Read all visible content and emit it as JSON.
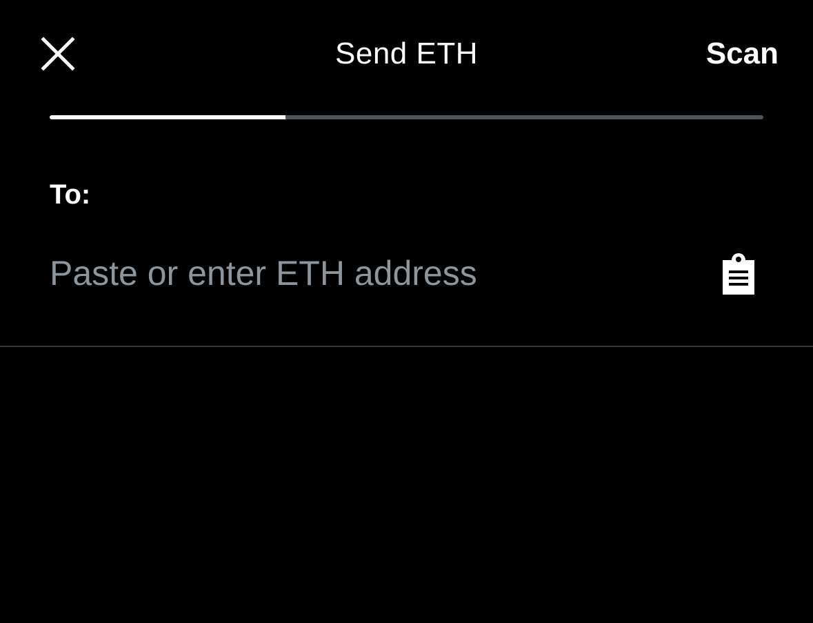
{
  "header": {
    "title": "Send ETH",
    "scan_label": "Scan",
    "close_icon": "close-icon"
  },
  "progress": {
    "fraction": 0.33,
    "fill_color": "#ffffff",
    "track_color": "#4e555a"
  },
  "recipient": {
    "label": "To:",
    "value": "",
    "placeholder": "Paste or enter ETH address",
    "paste_icon": "clipboard-icon"
  },
  "colors": {
    "background": "#000000",
    "text": "#ffffff",
    "placeholder": "#8c969c",
    "divider": "#33383c"
  }
}
